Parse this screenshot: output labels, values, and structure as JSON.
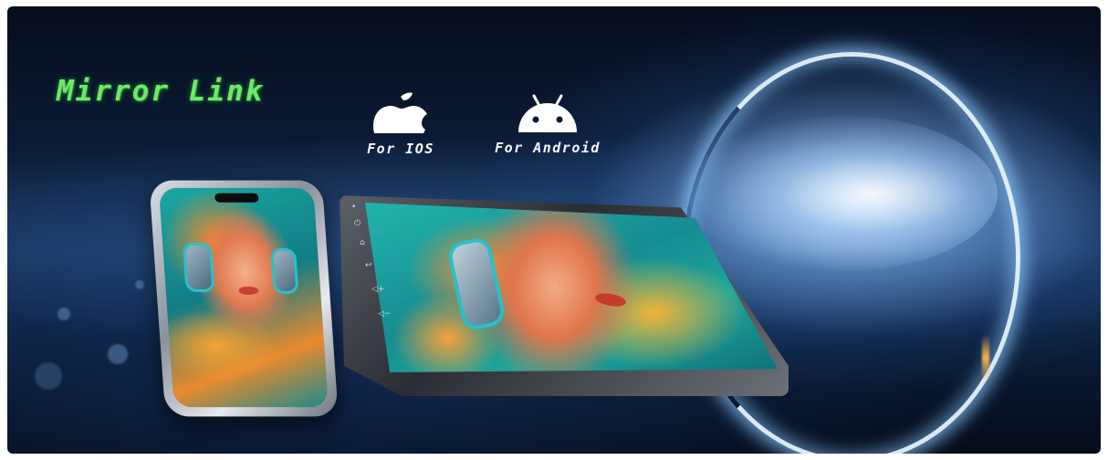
{
  "banner": {
    "title": "Mirror Link",
    "platforms": [
      {
        "icon": "apple-icon",
        "label": "For IOS"
      },
      {
        "icon": "android-icon",
        "label": "For Android"
      }
    ]
  },
  "colors": {
    "title": "#6fe86a",
    "label": "#f4f7ff",
    "background": "#0b1a33",
    "ring": "#e6f5ff"
  }
}
